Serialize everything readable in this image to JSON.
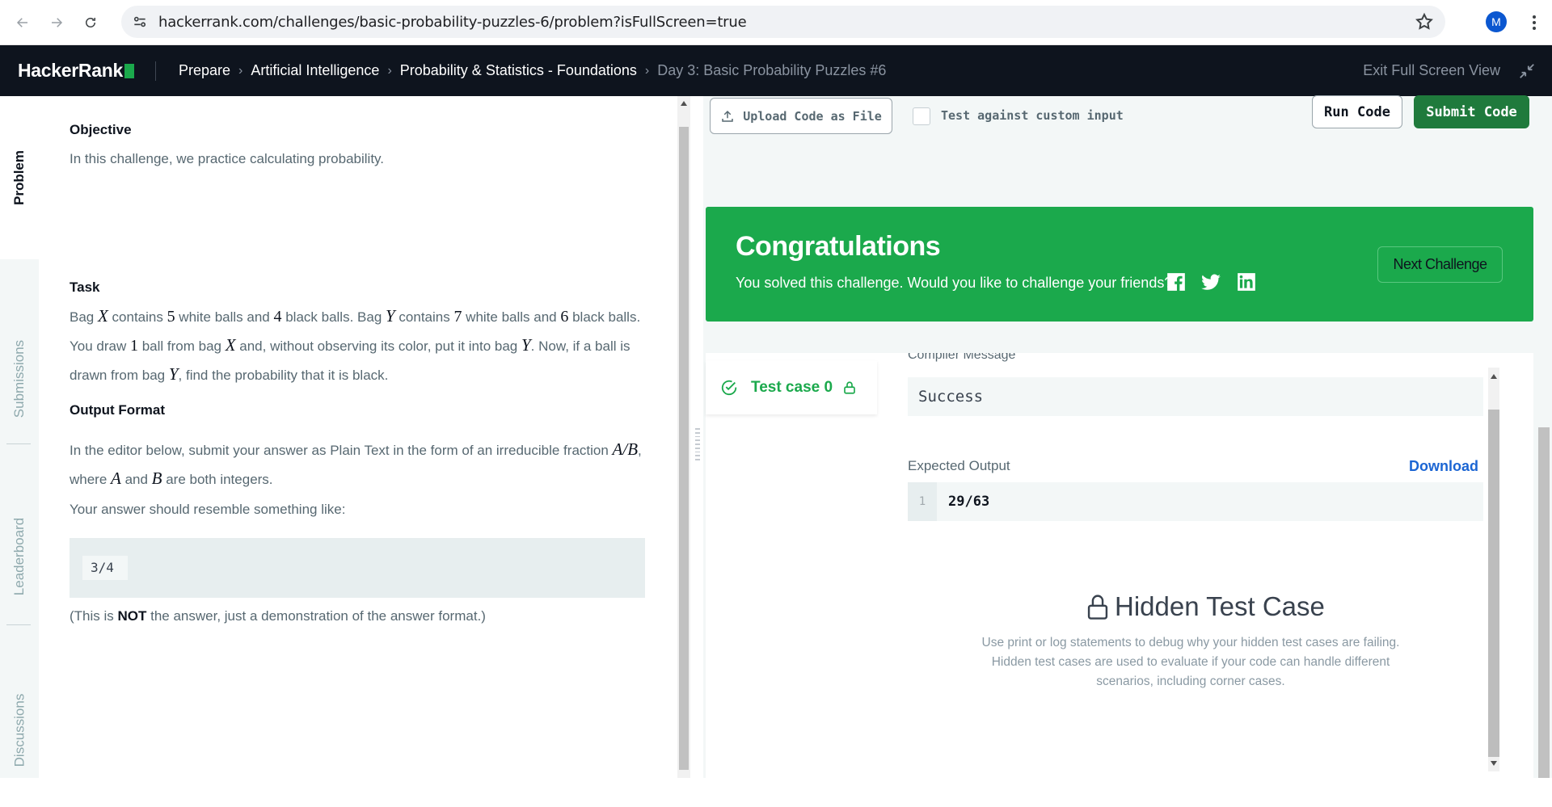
{
  "browser": {
    "url": "hackerrank.com/challenges/basic-probability-puzzles-6/problem?isFullScreen=true",
    "avatar_initial": "M"
  },
  "header": {
    "logo": "HackerRank",
    "breadcrumbs": [
      "Prepare",
      "Artificial Intelligence",
      "Probability & Statistics - Foundations",
      "Day 3: Basic Probability Puzzles #6"
    ],
    "exit_fullscreen": "Exit Full Screen View"
  },
  "sidebar": {
    "tabs": [
      "Problem",
      "Submissions",
      "Leaderboard",
      "Discussions"
    ],
    "active": "Problem"
  },
  "problem": {
    "objective_heading": "Objective",
    "objective_text": "In this challenge, we practice calculating probability.",
    "task_heading": "Task",
    "task_parts": {
      "t1": "Bag ",
      "X": "X",
      "t2": " contains ",
      "n5": "5",
      "t3": " white balls and ",
      "n4": "4",
      "t4": " black balls. Bag ",
      "Y": "Y",
      "t5": " contains ",
      "n7": "7",
      "t6": " white balls and ",
      "n6": "6",
      "t7": " black balls. You draw ",
      "n1": "1",
      "t8": " ball from bag ",
      "t9": " and, without observing its color, put it into bag ",
      "t10": ". Now, if a ball is drawn from bag ",
      "t11": ", find the probability that it is black."
    },
    "output_heading": "Output Format",
    "output_parts": {
      "t1": "In the editor below, submit your answer as Plain Text in the form of an irreducible fraction ",
      "AB": "A/B",
      "t2": ", where ",
      "A": "A",
      "t3": " and ",
      "B": "B",
      "t4": " are both integers."
    },
    "resemble_text": "Your answer should resemble something like:",
    "example_code": "3/4",
    "note_prefix": "(This is ",
    "note_bold": "NOT",
    "note_suffix": " the answer, just a demonstration of the answer format.)"
  },
  "editor": {
    "upload_label": "Upload Code as File",
    "custom_input_label": "Test against custom input",
    "custom_input_checked": false,
    "run_label": "Run Code",
    "submit_label": "Submit Code"
  },
  "congrats": {
    "title": "Congratulations",
    "subtitle": "You solved this challenge. Would you like to challenge your friends?",
    "next_label": "Next Challenge",
    "social_icons": [
      "facebook-icon",
      "twitter-icon",
      "linkedin-icon"
    ]
  },
  "results": {
    "test_case_label": "Test case 0",
    "compiler_label": "Compiler Message",
    "compiler_message": "Success",
    "expected_label": "Expected Output",
    "download_label": "Download",
    "line_number": "1",
    "expected_value": "29/63",
    "hidden_title": "Hidden Test Case",
    "hidden_desc": "Use print or log statements to debug why your hidden test cases are failing. Hidden test cases are used to evaluate if your code can handle different scenarios, including corner cases."
  },
  "colors": {
    "brand_green": "#1ba94c",
    "header_dark": "#0e141e",
    "link_blue": "#1b65d3"
  }
}
